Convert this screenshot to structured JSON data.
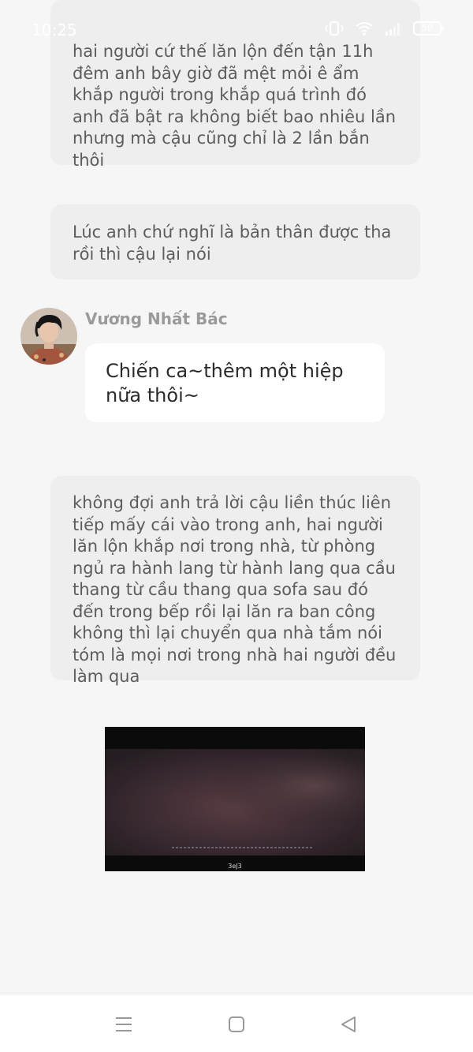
{
  "status_bar": {
    "time": "10:25",
    "battery": "50"
  },
  "messages": {
    "narration_1": "hai người cứ thế lăn lộn đến tận 11h đêm anh bây giờ đã mệt mỏi ê ẩm khắp người trong khắp quá trình đó anh đã bật ra không biết bao nhiêu lần nhưng mà cậu cũng chỉ là 2 lần bắn thôi",
    "narration_2": "Lúc anh chứ nghĩ là bản thân được tha rồi thì cậu lại nói",
    "character_message": {
      "sender": "Vương Nhất Bác",
      "text": "Chiến ca~thêm một hiệp nữa thôi~"
    },
    "narration_3": "không đợi anh trả lời cậu liền thúc liên tiếp mấy cái vào trong anh, hai người lăn lộn khắp nơi trong nhà, từ phòng ngủ ra hành lang từ hành lang qua cầu thang từ cầu thang qua sofa sau đó đến trong bếp rồi lại lăn ra ban công không thì lại chuyển qua nhà tắm nói tóm là mọi nơi trong nhà hai người đều làm qua",
    "image": {
      "caption_line": "",
      "watermark": "3eJ3"
    }
  },
  "nav_bar": {
    "icons": [
      "menu-icon",
      "home-icon",
      "back-icon"
    ]
  },
  "colors": {
    "background": "#f6f6f6",
    "narration_bubble": "#eeeeee",
    "message_bubble": "#ffffff",
    "sender_name": "#9a9a9a"
  }
}
